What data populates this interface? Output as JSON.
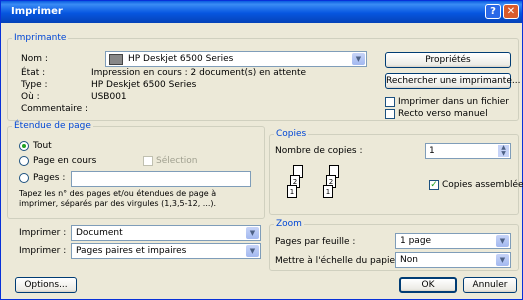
{
  "window": {
    "title": "Imprimer",
    "help": "?",
    "close": "✕"
  },
  "printer": {
    "legend": "Imprimante",
    "name_label": "Nom :",
    "name_value": "HP Deskjet 6500 Series",
    "state_label": "État :",
    "state_value": "Impression en cours : 2 document(s) en attente",
    "type_label": "Type :",
    "type_value": "HP Deskjet 6500 Series",
    "where_label": "Où :",
    "where_value": "USB001",
    "comment_label": "Commentaire :",
    "properties_button": "Propriétés",
    "find_printer_button": "Rechercher une imprimante...",
    "print_to_file_label": "Imprimer dans un fichier",
    "print_to_file_checked": false,
    "manual_duplex_label": "Recto verso manuel",
    "manual_duplex_checked": false
  },
  "range": {
    "legend": "Étendue de page",
    "all": "Tout",
    "current": "Page en cours",
    "selection": "Sélection",
    "pages": "Pages :",
    "selected": "all",
    "hint": "Tapez les n° des pages et/ou étendues de page à imprimer, séparés par des virgules (1,3,5-12, ...)."
  },
  "copies": {
    "legend": "Copies",
    "count_label": "Nombre de copies :",
    "count_value": "1",
    "collate_label": "Copies assemblées",
    "collate_checked": true
  },
  "print_what": {
    "label": "Imprimer :",
    "value": "Document"
  },
  "print_pages": {
    "label": "Imprimer :",
    "value": "Pages paires et impaires"
  },
  "zoom": {
    "legend": "Zoom",
    "pages_per_sheet_label": "Pages par feuille :",
    "pages_per_sheet_value": "1 page",
    "scale_label": "Mettre à l'échelle du papier :",
    "scale_value": "Non"
  },
  "footer": {
    "options": "Options...",
    "ok": "OK",
    "cancel": "Annuler"
  }
}
